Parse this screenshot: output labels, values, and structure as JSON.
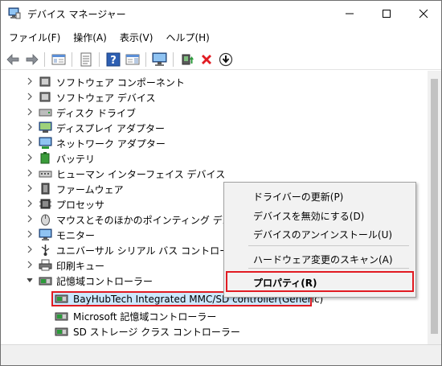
{
  "window": {
    "title": "デバイス マネージャー"
  },
  "menubar": {
    "items": [
      "ファイル(F)",
      "操作(A)",
      "表示(V)",
      "ヘルプ(H)"
    ]
  },
  "tree": {
    "rows": [
      {
        "label": "ソフトウェア コンポーネント",
        "icon": "software-component-icon",
        "expanded": false
      },
      {
        "label": "ソフトウェア デバイス",
        "icon": "software-device-icon",
        "expanded": false
      },
      {
        "label": "ディスク ドライブ",
        "icon": "disk-drive-icon",
        "expanded": false
      },
      {
        "label": "ディスプレイ アダプター",
        "icon": "display-adapter-icon",
        "expanded": false
      },
      {
        "label": "ネットワーク アダプター",
        "icon": "network-adapter-icon",
        "expanded": false
      },
      {
        "label": "バッテリ",
        "icon": "battery-icon",
        "expanded": false
      },
      {
        "label": "ヒューマン インターフェイス デバイス",
        "icon": "hid-icon",
        "expanded": false
      },
      {
        "label": "ファームウェア",
        "icon": "firmware-icon",
        "expanded": false
      },
      {
        "label": "プロセッサ",
        "icon": "processor-icon",
        "expanded": false
      },
      {
        "label": "マウスとそのほかのポインティング デバイス",
        "icon": "mouse-icon",
        "expanded": false
      },
      {
        "label": "モニター",
        "icon": "monitor-icon",
        "expanded": false
      },
      {
        "label": "ユニバーサル シリアル バス コントローラー",
        "icon": "usb-icon",
        "expanded": false
      },
      {
        "label": "印刷キュー",
        "icon": "printer-icon",
        "expanded": false
      },
      {
        "label": "記憶域コントローラー",
        "icon": "storage-controller-icon",
        "expanded": true
      }
    ],
    "children": [
      {
        "label": "BayHubTech Integrated MMC/SD controller(Generic)",
        "selected": true
      },
      {
        "label": "Microsoft 記憶域コントローラー",
        "selected": false
      },
      {
        "label": "SD ストレージ クラス コントローラー",
        "selected": false
      }
    ]
  },
  "context_menu": {
    "items": [
      "ドライバーの更新(P)",
      "デバイスを無効にする(D)",
      "デバイスのアンインストール(U)",
      "ハードウェア変更のスキャン(A)",
      "プロパティ(R)"
    ],
    "highlighted_index": 4
  },
  "colors": {
    "highlight_border": "#e11b22",
    "selection_fill": "#cce8ff",
    "menu_bg": "#f2f2f2"
  }
}
